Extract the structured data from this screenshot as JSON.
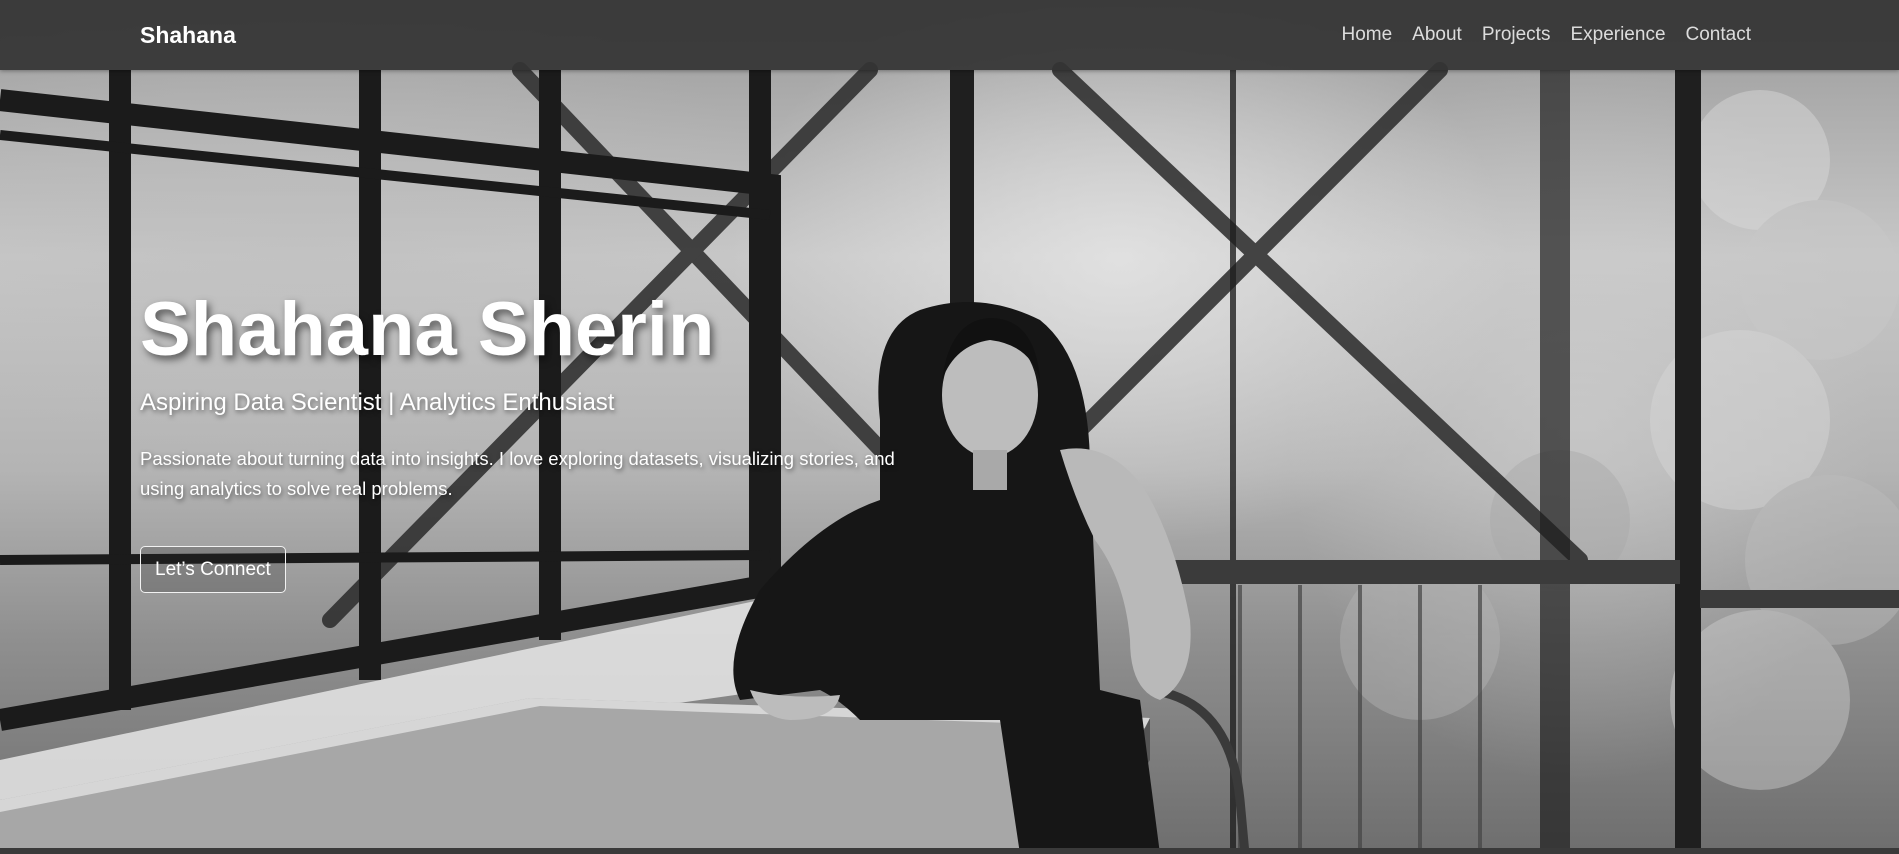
{
  "nav": {
    "brand": "Shahana",
    "links": [
      {
        "label": "Home"
      },
      {
        "label": "About"
      },
      {
        "label": "Projects"
      },
      {
        "label": "Experience"
      },
      {
        "label": "Contact"
      }
    ]
  },
  "hero": {
    "name": "Shahana Sherin",
    "tagline": "Aspiring Data Scientist | Analytics Enthusiast",
    "description": "Passionate about turning data into insights. I love exploring datasets, visualizing stories, and using analytics to solve real problems.",
    "cta_label": "Let’s Connect"
  },
  "theme": {
    "navbar_bg": "#343434",
    "text_color": "#ffffff",
    "nav_link_color": "#dcdcdc"
  },
  "background": {
    "description_icon": "bw-portrait-photo",
    "style": "black-and-white"
  }
}
